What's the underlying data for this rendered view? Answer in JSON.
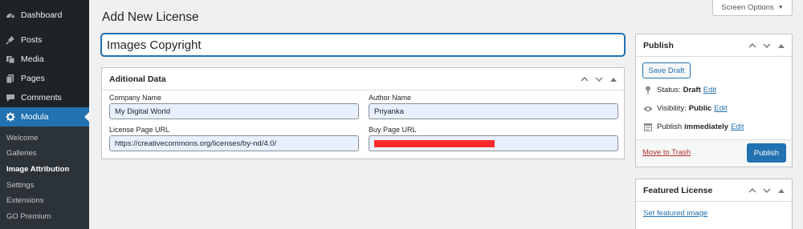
{
  "sidebar": {
    "items": [
      {
        "label": "Dashboard",
        "icon": "dashboard-icon"
      },
      {
        "label": "Posts",
        "icon": "pin-icon"
      },
      {
        "label": "Media",
        "icon": "media-icon"
      },
      {
        "label": "Pages",
        "icon": "pages-icon"
      },
      {
        "label": "Comments",
        "icon": "comment-icon"
      },
      {
        "label": "Modula",
        "icon": "gear-icon",
        "active": true
      }
    ],
    "submenu": [
      {
        "label": "Welcome"
      },
      {
        "label": "Galleries"
      },
      {
        "label": "Image Attribution",
        "current": true
      },
      {
        "label": "Settings"
      },
      {
        "label": "Extensions"
      },
      {
        "label": "GO Premium"
      }
    ]
  },
  "header": {
    "page_title": "Add New License",
    "screen_options": "Screen Options"
  },
  "title_input": {
    "value": "Images Copyright"
  },
  "additional_data": {
    "title": "Aditional Data",
    "company_label": "Company Name",
    "company_value": "My Digital World",
    "author_label": "Author Name",
    "author_value": "Priyanka",
    "license_url_label": "License Page URL",
    "license_url_value": "https://creativecommons.org/licenses/by-nd/4.0/",
    "buy_url_label": "Buy Page URL"
  },
  "publish": {
    "title": "Publish",
    "save_draft": "Save Draft",
    "status_label": "Status:",
    "status_value": "Draft",
    "visibility_label": "Visibility:",
    "visibility_value": "Public",
    "schedule_label": "Publish",
    "schedule_value": "immediately",
    "edit": "Edit",
    "move_to_trash": "Move to Trash",
    "publish_button": "Publish"
  },
  "featured_license": {
    "title": "Featured License",
    "set_link": "Set featured image"
  },
  "colors": {
    "accent": "#2271b1",
    "sidebar_bg": "#1d2327",
    "redaction": "#ff2a2a"
  }
}
